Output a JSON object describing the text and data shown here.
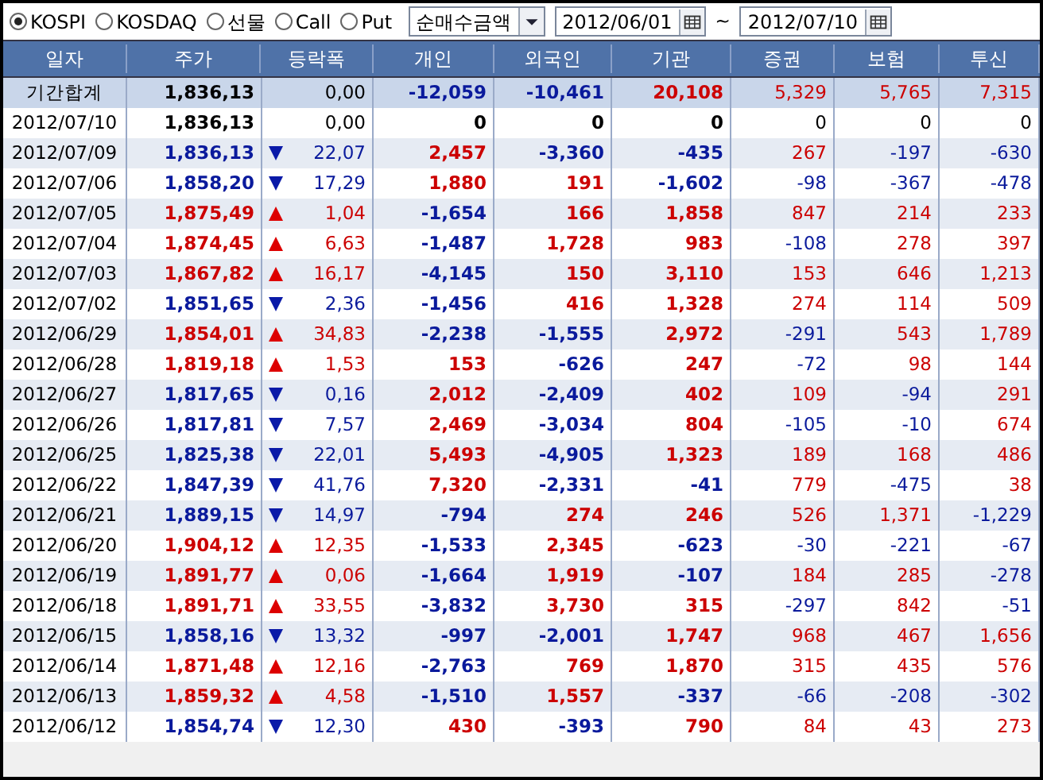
{
  "markets": [
    {
      "label": "KOSPI",
      "selected": true
    },
    {
      "label": "KOSDAQ",
      "selected": false
    },
    {
      "label": "선물",
      "selected": false
    },
    {
      "label": "Call",
      "selected": false
    },
    {
      "label": "Put",
      "selected": false
    }
  ],
  "measure": {
    "value": "순매수금액"
  },
  "date_from": "2012/06/01",
  "range_separator": "~",
  "date_to": "2012/07/10",
  "table": {
    "columns": [
      "일자",
      "주가",
      "등락폭",
      "개인",
      "외국인",
      "기관",
      "증권",
      "보험",
      "투신"
    ],
    "summary": {
      "date": "기간합계",
      "price": "1,836,13",
      "change": "0,00",
      "individual": "-12,059",
      "foreign": "-10,461",
      "institution": "20,108",
      "securities": "5,329",
      "insurance": "5,765",
      "trust": "7,315"
    },
    "rows": [
      {
        "date": "2012/07/10",
        "price": "1,836,13",
        "change": "0,00",
        "individual": "0",
        "foreign": "0",
        "institution": "0",
        "securities": "0",
        "insurance": "0",
        "trust": "0"
      },
      {
        "date": "2012/07/09",
        "price": "1,836,13",
        "kind": "down",
        "change": "22,07",
        "individual": "2,457",
        "foreign": "-3,360",
        "institution": "-435",
        "securities": "267",
        "insurance": "-197",
        "trust": "-630"
      },
      {
        "date": "2012/07/06",
        "price": "1,858,20",
        "kind": "down",
        "change": "17,29",
        "individual": "1,880",
        "foreign": "191",
        "institution": "-1,602",
        "securities": "-98",
        "insurance": "-367",
        "trust": "-478"
      },
      {
        "date": "2012/07/05",
        "price": "1,875,49",
        "kind": "up",
        "change": "1,04",
        "individual": "-1,654",
        "foreign": "166",
        "institution": "1,858",
        "securities": "847",
        "insurance": "214",
        "trust": "233"
      },
      {
        "date": "2012/07/04",
        "price": "1,874,45",
        "kind": "up",
        "change": "6,63",
        "individual": "-1,487",
        "foreign": "1,728",
        "institution": "983",
        "securities": "-108",
        "insurance": "278",
        "trust": "397"
      },
      {
        "date": "2012/07/03",
        "price": "1,867,82",
        "kind": "up",
        "change": "16,17",
        "individual": "-4,145",
        "foreign": "150",
        "institution": "3,110",
        "securities": "153",
        "insurance": "646",
        "trust": "1,213"
      },
      {
        "date": "2012/07/02",
        "price": "1,851,65",
        "kind": "down",
        "change": "2,36",
        "individual": "-1,456",
        "foreign": "416",
        "institution": "1,328",
        "securities": "274",
        "insurance": "114",
        "trust": "509"
      },
      {
        "date": "2012/06/29",
        "price": "1,854,01",
        "kind": "up",
        "change": "34,83",
        "individual": "-2,238",
        "foreign": "-1,555",
        "institution": "2,972",
        "securities": "-291",
        "insurance": "543",
        "trust": "1,789"
      },
      {
        "date": "2012/06/28",
        "price": "1,819,18",
        "kind": "up",
        "change": "1,53",
        "individual": "153",
        "foreign": "-626",
        "institution": "247",
        "securities": "-72",
        "insurance": "98",
        "trust": "144"
      },
      {
        "date": "2012/06/27",
        "price": "1,817,65",
        "kind": "down",
        "change": "0,16",
        "individual": "2,012",
        "foreign": "-2,409",
        "institution": "402",
        "securities": "109",
        "insurance": "-94",
        "trust": "291"
      },
      {
        "date": "2012/06/26",
        "price": "1,817,81",
        "kind": "down",
        "change": "7,57",
        "individual": "2,469",
        "foreign": "-3,034",
        "institution": "804",
        "securities": "-105",
        "insurance": "-10",
        "trust": "674"
      },
      {
        "date": "2012/06/25",
        "price": "1,825,38",
        "kind": "down",
        "change": "22,01",
        "individual": "5,493",
        "foreign": "-4,905",
        "institution": "1,323",
        "securities": "189",
        "insurance": "168",
        "trust": "486"
      },
      {
        "date": "2012/06/22",
        "price": "1,847,39",
        "kind": "down",
        "change": "41,76",
        "individual": "7,320",
        "foreign": "-2,331",
        "institution": "-41",
        "securities": "779",
        "insurance": "-475",
        "trust": "38"
      },
      {
        "date": "2012/06/21",
        "price": "1,889,15",
        "kind": "down",
        "change": "14,97",
        "individual": "-794",
        "foreign": "274",
        "institution": "246",
        "securities": "526",
        "insurance": "1,371",
        "trust": "-1,229"
      },
      {
        "date": "2012/06/20",
        "price": "1,904,12",
        "kind": "up",
        "change": "12,35",
        "individual": "-1,533",
        "foreign": "2,345",
        "institution": "-623",
        "securities": "-30",
        "insurance": "-221",
        "trust": "-67"
      },
      {
        "date": "2012/06/19",
        "price": "1,891,77",
        "kind": "up",
        "change": "0,06",
        "individual": "-1,664",
        "foreign": "1,919",
        "institution": "-107",
        "securities": "184",
        "insurance": "285",
        "trust": "-278"
      },
      {
        "date": "2012/06/18",
        "price": "1,891,71",
        "kind": "up",
        "change": "33,55",
        "individual": "-3,832",
        "foreign": "3,730",
        "institution": "315",
        "securities": "-297",
        "insurance": "842",
        "trust": "-51"
      },
      {
        "date": "2012/06/15",
        "price": "1,858,16",
        "kind": "down",
        "change": "13,32",
        "individual": "-997",
        "foreign": "-2,001",
        "institution": "1,747",
        "securities": "968",
        "insurance": "467",
        "trust": "1,656"
      },
      {
        "date": "2012/06/14",
        "price": "1,871,48",
        "kind": "up",
        "change": "12,16",
        "individual": "-2,763",
        "foreign": "769",
        "institution": "1,870",
        "securities": "315",
        "insurance": "435",
        "trust": "576"
      },
      {
        "date": "2012/06/13",
        "price": "1,859,32",
        "kind": "up",
        "change": "4,58",
        "individual": "-1,510",
        "foreign": "1,557",
        "institution": "-337",
        "securities": "-66",
        "insurance": "-208",
        "trust": "-302"
      },
      {
        "date": "2012/06/12",
        "price": "1,854,74",
        "kind": "down",
        "change": "12,30",
        "individual": "430",
        "foreign": "-393",
        "institution": "790",
        "securities": "84",
        "insurance": "43",
        "trust": "273"
      }
    ]
  }
}
